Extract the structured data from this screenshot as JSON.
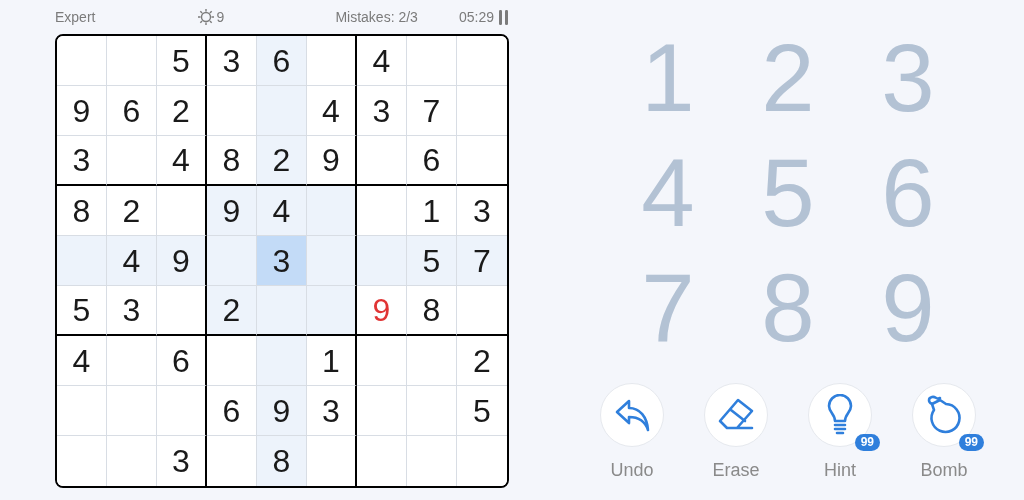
{
  "top_bar": {
    "difficulty": "Expert",
    "score": "9",
    "mistakes": "Mistakes: 2/3",
    "timer": "05:29"
  },
  "grid": [
    [
      {
        "selected": false
      },
      {
        "selected": false
      },
      {
        "value": "5",
        "selected": false,
        "error": false
      },
      {
        "value": "3",
        "selected": false,
        "error": false
      },
      {
        "value": "6",
        "selected": false,
        "error": false
      },
      {
        "selected": false
      },
      {
        "value": "4",
        "selected": false,
        "error": false
      },
      {
        "selected": false
      },
      {
        "selected": false
      }
    ],
    [
      {
        "value": "9",
        "selected": false,
        "error": false
      },
      {
        "value": "6",
        "selected": false,
        "error": false
      },
      {
        "value": "2",
        "selected": false,
        "error": false
      },
      {
        "selected": false
      },
      {
        "selected": false
      },
      {
        "value": "4",
        "selected": false,
        "error": false
      },
      {
        "value": "3",
        "selected": false,
        "error": false
      },
      {
        "value": "7",
        "selected": false,
        "error": false
      },
      {
        "selected": false
      }
    ],
    [
      {
        "value": "3",
        "selected": false,
        "error": false
      },
      {
        "selected": false
      },
      {
        "value": "4",
        "selected": false,
        "error": false
      },
      {
        "value": "8",
        "selected": false,
        "error": false
      },
      {
        "value": "2",
        "selected": false,
        "error": false
      },
      {
        "value": "9",
        "selected": false,
        "error": false
      },
      {
        "selected": false
      },
      {
        "value": "6",
        "selected": false,
        "error": false
      },
      {
        "selected": false
      }
    ],
    [
      {
        "value": "8",
        "selected": false,
        "error": false
      },
      {
        "value": "2",
        "selected": false,
        "error": false
      },
      {
        "selected": false
      },
      {
        "value": "9",
        "selected": false,
        "error": false
      },
      {
        "value": "4",
        "selected": false,
        "error": false
      },
      {
        "selected": false
      },
      {
        "selected": false
      },
      {
        "value": "1",
        "selected": false,
        "error": false
      },
      {
        "value": "3",
        "selected": false,
        "error": false
      }
    ],
    [
      {
        "selected": false
      },
      {
        "value": "4",
        "selected": false,
        "error": false
      },
      {
        "value": "9",
        "selected": false,
        "error": false
      },
      {
        "selected": false
      },
      {
        "value": "3",
        "selected": true,
        "error": false
      },
      {
        "selected": false
      },
      {
        "selected": false
      },
      {
        "value": "5",
        "selected": false,
        "error": false
      },
      {
        "value": "7",
        "selected": false,
        "error": false
      }
    ],
    [
      {
        "value": "5",
        "selected": false,
        "error": false
      },
      {
        "value": "3",
        "selected": false,
        "error": false
      },
      {
        "selected": false
      },
      {
        "value": "2",
        "selected": false,
        "error": false
      },
      {
        "selected": false
      },
      {
        "selected": false
      },
      {
        "value": "9",
        "selected": false,
        "error": true
      },
      {
        "value": "8",
        "selected": false,
        "error": false
      },
      {
        "selected": false
      }
    ],
    [
      {
        "value": "4",
        "selected": false,
        "error": false
      },
      {
        "selected": false
      },
      {
        "value": "6",
        "selected": false,
        "error": false
      },
      {
        "selected": false
      },
      {
        "selected": false
      },
      {
        "value": "1",
        "selected": false,
        "error": false
      },
      {
        "selected": false
      },
      {
        "selected": false
      },
      {
        "value": "2",
        "selected": false,
        "error": false
      }
    ],
    [
      {
        "selected": false
      },
      {
        "selected": false
      },
      {
        "selected": false
      },
      {
        "value": "6",
        "selected": false,
        "error": false
      },
      {
        "value": "9",
        "selected": false,
        "error": false
      },
      {
        "value": "3",
        "selected": false,
        "error": false
      },
      {
        "selected": false
      },
      {
        "selected": false
      },
      {
        "value": "5",
        "selected": false,
        "error": false
      }
    ],
    [
      {
        "selected": false
      },
      {
        "selected": false
      },
      {
        "value": "3",
        "selected": false,
        "error": false
      },
      {
        "selected": false
      },
      {
        "value": "8",
        "selected": false,
        "error": false
      },
      {
        "selected": false
      },
      {
        "selected": false
      },
      {
        "selected": false
      },
      {
        "selected": false
      }
    ]
  ],
  "number_pad": [
    "1",
    "2",
    "3",
    "4",
    "5",
    "6",
    "7",
    "8",
    "9"
  ],
  "tools": [
    {
      "kind": "undo",
      "label": "Undo"
    },
    {
      "kind": "erase",
      "label": "Erase"
    },
    {
      "kind": "hint",
      "label": "Hint",
      "badge": "99"
    },
    {
      "kind": "bomb",
      "label": "Bomb",
      "badge": "99"
    }
  ]
}
